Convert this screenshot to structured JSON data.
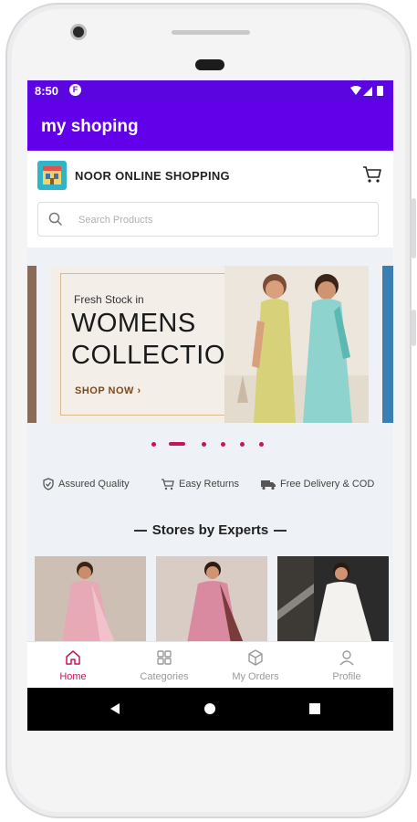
{
  "status_bar": {
    "time": "8:50",
    "app_icon": "F"
  },
  "app_bar": {
    "title": "my shoping"
  },
  "store": {
    "name": "NOOR ONLINE SHOPPING",
    "logo_icon": "store-logo-icon",
    "cart_icon": "cart-icon"
  },
  "search": {
    "placeholder": "Search Products",
    "value": ""
  },
  "banner": {
    "kicker": "Fresh Stock in",
    "title_line1": "WOMENS",
    "title_line2": "COLLECTION",
    "cta": "SHOP NOW ›",
    "carousel_pages": 6,
    "active_page": 1
  },
  "features": [
    {
      "label": "Assured Quality",
      "icon": "shield-check-icon"
    },
    {
      "label": "Easy Returns",
      "icon": "return-cart-icon"
    },
    {
      "label": "Free Delivery & COD",
      "icon": "truck-icon"
    }
  ],
  "section": {
    "title": "Stores by Experts"
  },
  "stores": [
    {
      "name": "store-1",
      "icon": "saree-model-pink"
    },
    {
      "name": "store-2",
      "icon": "saree-model-rose"
    },
    {
      "name": "store-3",
      "icon": "gown-model-white"
    }
  ],
  "bottom_nav": [
    {
      "label": "Home",
      "icon": "home-icon",
      "active": true
    },
    {
      "label": "Categories",
      "icon": "grid-icon",
      "active": false
    },
    {
      "label": "My Orders",
      "icon": "box-icon",
      "active": false
    },
    {
      "label": "Profile",
      "icon": "person-icon",
      "active": false
    }
  ],
  "colors": {
    "primary": "#6200ea",
    "status": "#5b06e1",
    "accent": "#c2185b"
  }
}
